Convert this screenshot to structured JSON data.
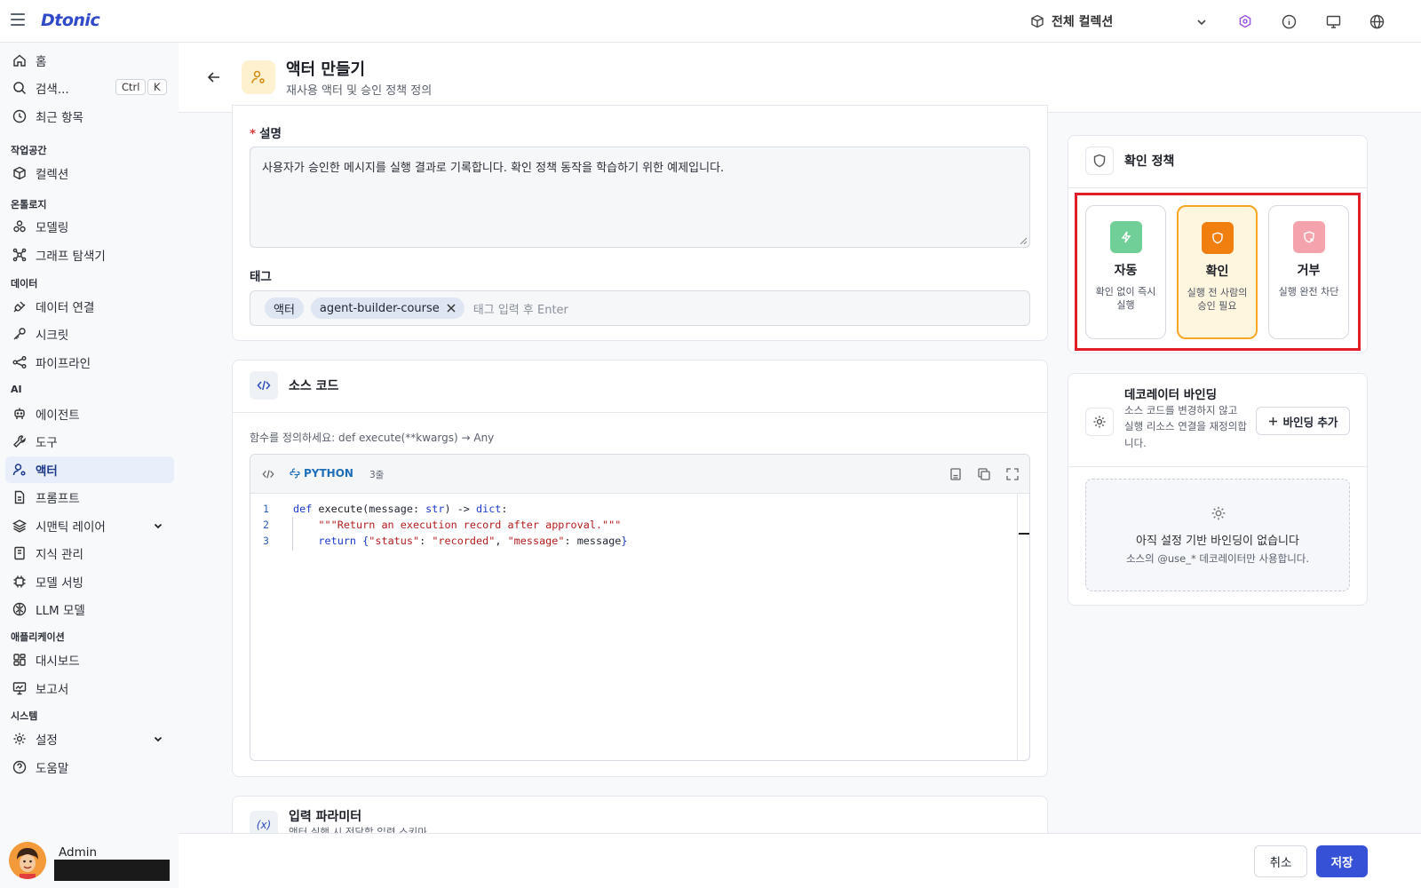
{
  "app": {
    "logo": "Dtonic"
  },
  "topbar": {
    "collection": "전체 컬렉션"
  },
  "sidebar": {
    "home": "홈",
    "search": "검색...",
    "search_kbd_ctrl": "Ctrl",
    "search_kbd_k": "K",
    "recent": "최근 항목",
    "sections": {
      "workspace": "작업공간",
      "ontology": "온톨로지",
      "data": "데이터",
      "ai": "AI",
      "apps": "애플리케이션",
      "system": "시스템"
    },
    "items": {
      "collection": "컬렉션",
      "modeling": "모델링",
      "graph": "그래프 탐색기",
      "data_conn": "데이터 연결",
      "secret": "시크릿",
      "pipeline": "파이프라인",
      "agent": "에이전트",
      "tool": "도구",
      "actor": "액터",
      "prompt": "프롬프트",
      "semantic": "시맨틱 레이어",
      "knowledge": "지식 관리",
      "serving": "모델 서빙",
      "llm": "LLM 모델",
      "dashboard": "대시보드",
      "report": "보고서",
      "settings": "설정",
      "help": "도움말"
    },
    "user": "Admin"
  },
  "header": {
    "title": "액터 만들기",
    "subtitle": "재사용 액터 및 승인 정책 정의"
  },
  "form": {
    "desc_label": "설명",
    "desc_value": "사용자가 승인한 메시지를 실행 결과로 기록합니다. 확인 정책 동작을 학습하기 위한 예제입니다.",
    "tags_label": "태그",
    "tags": [
      "액터",
      "agent-builder-course"
    ],
    "tag_placeholder": "태그 입력 후 Enter"
  },
  "source": {
    "title": "소스 코드",
    "hint": "함수를 정의하세요: def execute(**kwargs) → Any",
    "language": "PYTHON",
    "line_count": "3줄",
    "lines": [
      "1",
      "2",
      "3"
    ]
  },
  "params": {
    "title": "입력 파라미터",
    "subtitle": "액터 실행 시 전달할 입력 스키마"
  },
  "policy": {
    "title": "확인 정책",
    "options": [
      {
        "label": "자동",
        "desc": "확인 없이 즉시 실행",
        "color": "#6fcf97"
      },
      {
        "label": "확인",
        "desc": "실행 전 사람의 승인 필요",
        "color": "#f07f10"
      },
      {
        "label": "거부",
        "desc": "실행 완전 차단",
        "color": "#f4a3ad"
      }
    ],
    "selected": "확인"
  },
  "binding": {
    "title": "데코레이터 바인딩",
    "desc": "소스 코드를 변경하지 않고 실행 리소스 연결을 재정의합니다.",
    "add_label": "바인딩 추가",
    "empty_title": "아직 설정 기반 바인딩이 없습니다",
    "empty_desc": "소스의 @use_* 데코레이터만 사용합니다."
  },
  "footer": {
    "cancel": "취소",
    "save": "저장"
  },
  "colors": {
    "accent": "#3651d6",
    "selected_border": "#f5a623",
    "highlight": "#e11d2a"
  }
}
